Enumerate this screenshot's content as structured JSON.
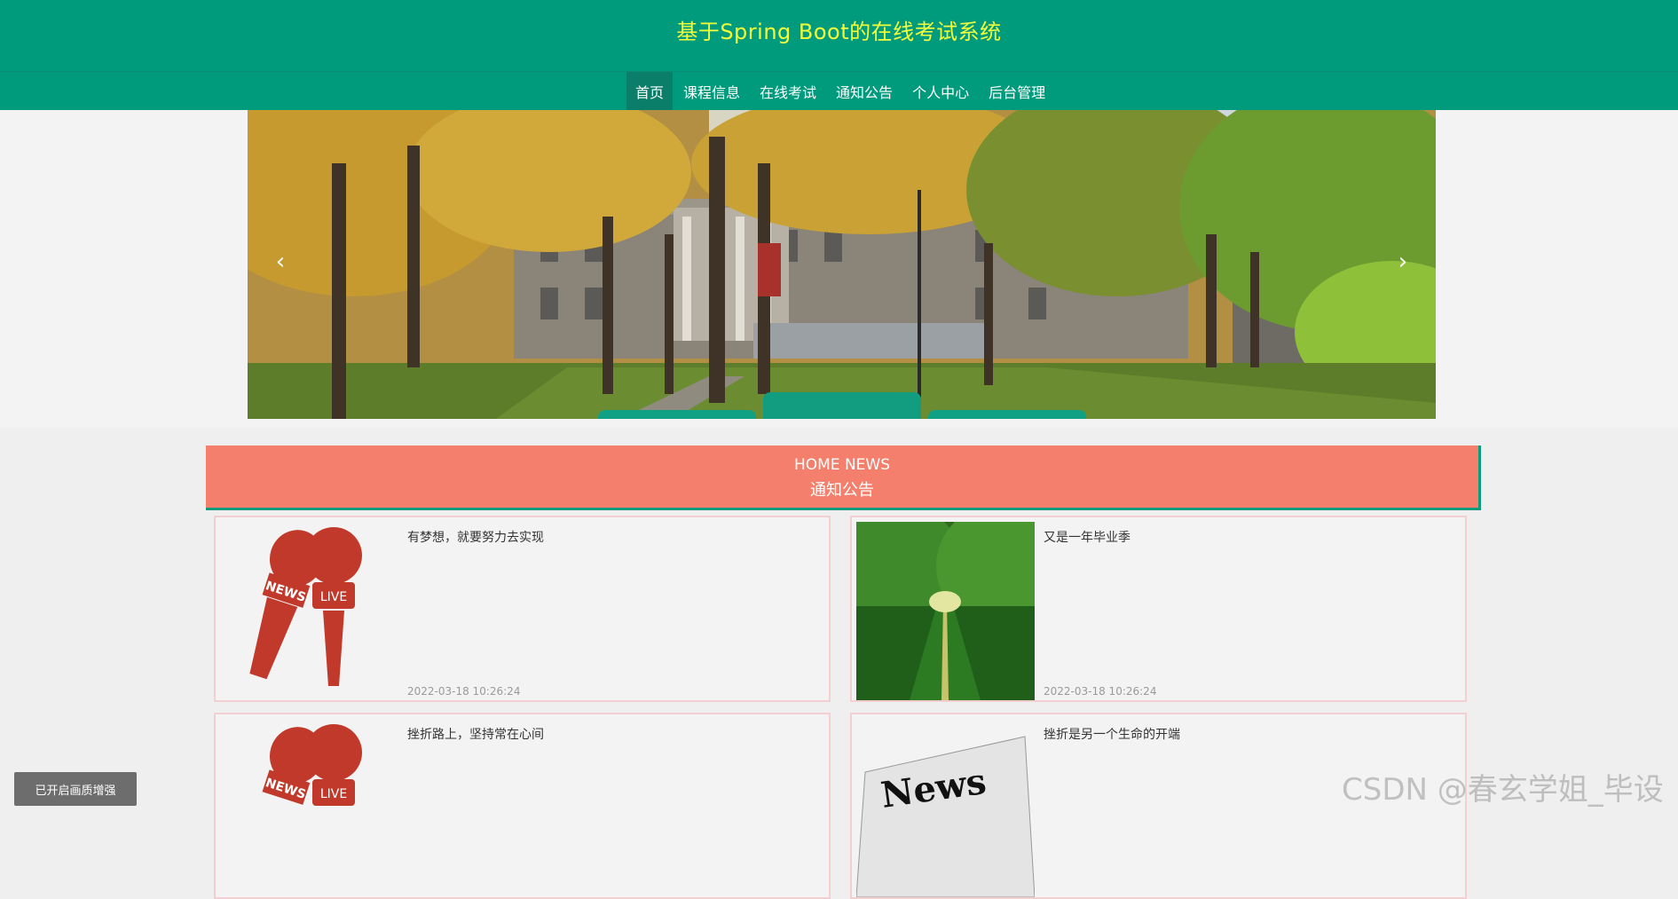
{
  "header": {
    "title": "基于Spring Boot的在线考试系统"
  },
  "nav": {
    "items": [
      {
        "label": "首页"
      },
      {
        "label": "课程信息"
      },
      {
        "label": "在线考试"
      },
      {
        "label": "通知公告"
      },
      {
        "label": "个人中心"
      },
      {
        "label": "后台管理"
      }
    ]
  },
  "banner": {
    "prev_icon": "chevron-left-icon",
    "next_icon": "chevron-right-icon"
  },
  "news": {
    "heading_en": "HOME NEWS",
    "heading_cn": "通知公告",
    "items": [
      {
        "title": "有梦想，就要努力去实现",
        "time": "2022-03-18 10:26:24",
        "image": "news-microphone"
      },
      {
        "title": "又是一年毕业季",
        "time": "2022-03-18 10:26:24",
        "image": "tree-path"
      },
      {
        "title": "挫折路上，坚持常在心间",
        "time": "",
        "image": "news-microphone"
      },
      {
        "title": "挫折是另一个生命的开端",
        "time": "",
        "image": "newspaper"
      }
    ]
  },
  "overlay": {
    "quality_badge": "已开启画质增强",
    "watermark": "CSDN @春玄学姐_毕设"
  },
  "colors": {
    "primary": "#009b7d",
    "title": "#f4ff3a",
    "news_header": "#f47f6c"
  }
}
